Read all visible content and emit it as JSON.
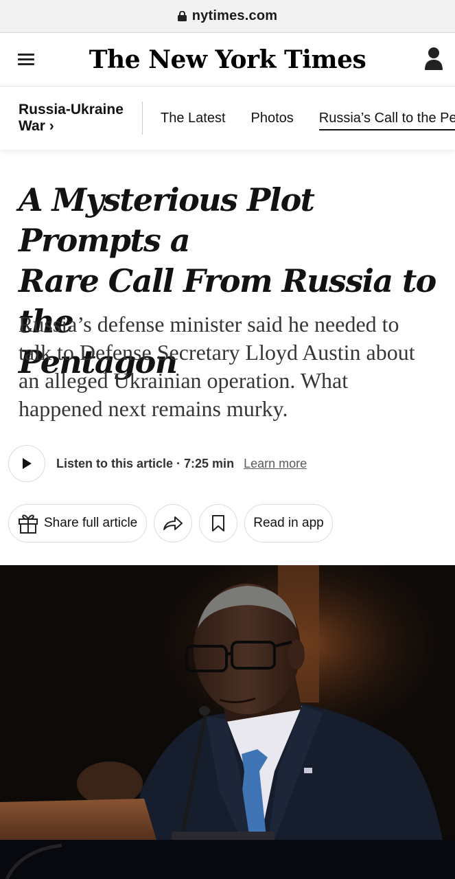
{
  "browser": {
    "url": "nytimes.com"
  },
  "masthead": {
    "logo": "The New York Times",
    "menu_icon": "hamburger-icon",
    "account_icon": "person-icon"
  },
  "section": {
    "title_line1": "Russia-Ukraine",
    "title_line2": "War ›",
    "links": [
      "The Latest",
      "Photos",
      "Russia’s Call to the Pe"
    ]
  },
  "article": {
    "headline_lines": [
      "A Mysterious Plot Prompts a",
      "Rare Call From Russia to the",
      "Pentagon"
    ],
    "summary_lines": [
      "Russia’s defense minister said he needed to",
      "talk to Defense Secretary Lloyd Austin about",
      "an alleged Ukrainian operation. What",
      "happened next remains murky."
    ]
  },
  "audio": {
    "label": "Listen to this article · 7:25 min",
    "learn_more": "Learn more"
  },
  "actions": {
    "share_label": "Share full article",
    "read_in_app": "Read in app"
  },
  "colors": {
    "text": "#121212",
    "summary": "#363636",
    "border": "#dcdcdc",
    "photo_bg": "#0e0a08",
    "tie": "#3f74b5"
  }
}
